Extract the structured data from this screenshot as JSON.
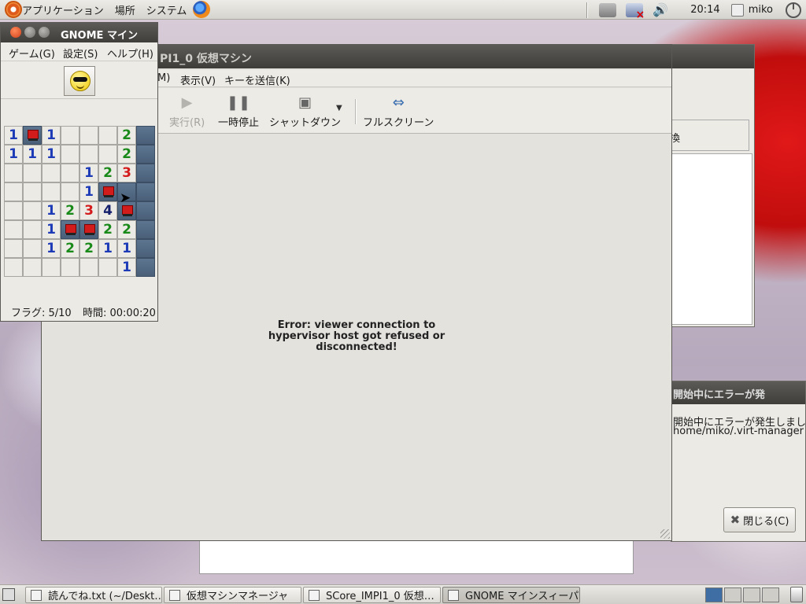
{
  "top_panel": {
    "menu_applications": "アプリケーション",
    "menu_places": "場所",
    "menu_system": "システム",
    "clock": "20:14",
    "user": "miko"
  },
  "vm_window": {
    "title": "PI1_0 仮想マシン",
    "menus": [
      "M)",
      "表示(V)",
      "キーを送信(K)"
    ],
    "toolbar": {
      "run": "実行(R)",
      "pause": "一時停止",
      "shutdown": "シャットダウン",
      "fullscreen": "フルスクリーン"
    },
    "error_line1": "Error: viewer connection to",
    "error_line2": "hypervisor host got refused or",
    "error_line3": "disconnected!"
  },
  "back_window": {
    "button_fragment": "換"
  },
  "error_dialog": {
    "title": "開始中にエラーが発",
    "line1": "開始中にエラーが発生しまし",
    "line2": "home/miko/.virt-manager",
    "close_button": "閉じる(C)"
  },
  "minesweeper": {
    "title": "GNOME マイン",
    "menu_game": "ゲーム(G)",
    "menu_settings": "設定(S)",
    "menu_help": "ヘルプ(H)",
    "flags": "フラグ: 5/10",
    "time": "時間: 00:00:20",
    "board": [
      [
        "1",
        "F",
        "1",
        "",
        "",
        "",
        "2",
        "#"
      ],
      [
        "1",
        "1",
        "1",
        "",
        "",
        "",
        "2",
        "#"
      ],
      [
        "",
        "",
        "",
        "",
        "1",
        "2",
        "3",
        "#"
      ],
      [
        "",
        "",
        "",
        "",
        "1",
        "F",
        "#",
        "#"
      ],
      [
        "",
        "",
        "1",
        "2",
        "3",
        "4",
        "F",
        "#"
      ],
      [
        "",
        "",
        "1",
        "F",
        "F",
        "2",
        "2",
        "#"
      ],
      [
        "",
        "",
        "1",
        "2",
        "2",
        "1",
        "1",
        "#"
      ],
      [
        "",
        "",
        "",
        "",
        "",
        "",
        "1",
        "#"
      ]
    ]
  },
  "taskbar": {
    "tasks": [
      "読んでね.txt (~/Deskt…",
      "仮想マシンマネージャ",
      "SCore_IMPI1_0 仮想…",
      "GNOME マインスィーパ"
    ]
  }
}
